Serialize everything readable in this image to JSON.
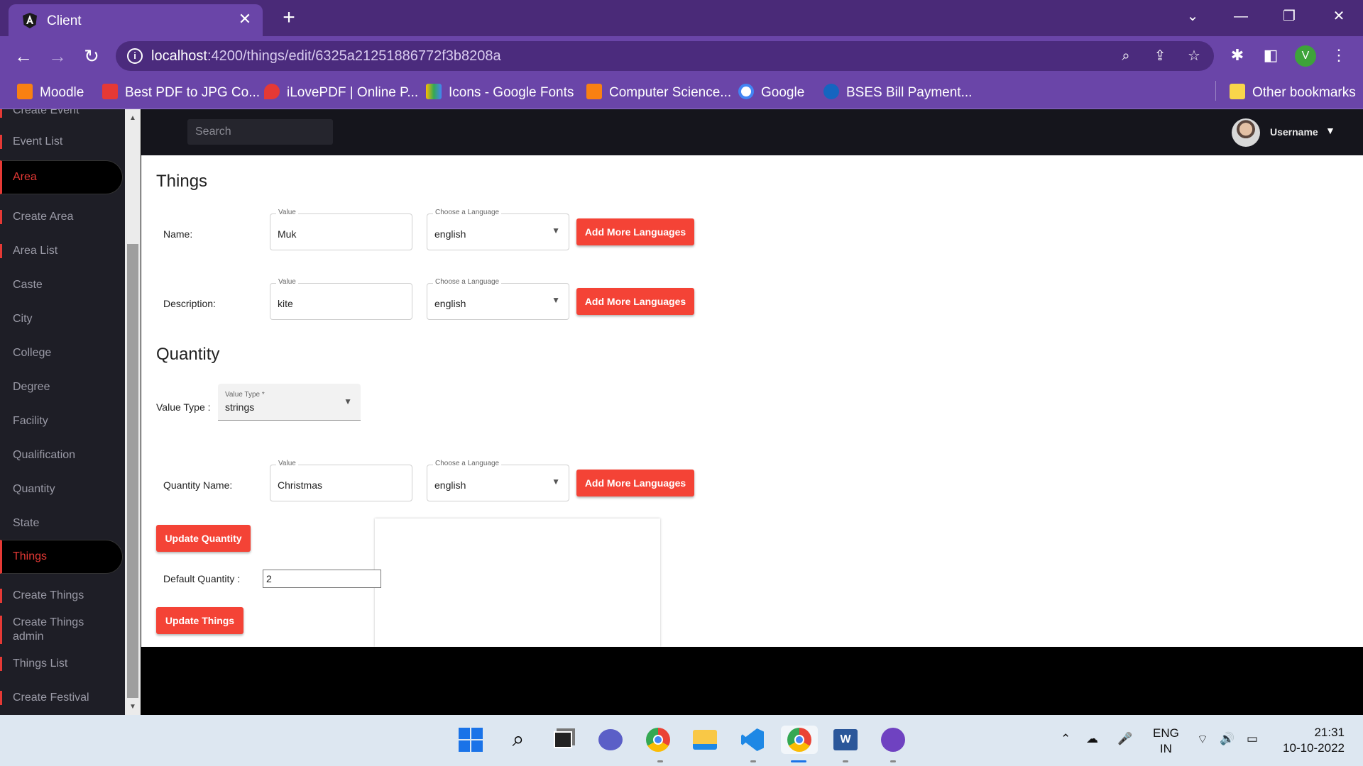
{
  "browser": {
    "tab_title": "Client",
    "url_host": "localhost",
    "url_rest": ":4200/things/edit/6325a21251886772f3b8208a",
    "bookmarks": [
      {
        "label": "Moodle",
        "color": "#f98012"
      },
      {
        "label": "Best PDF to JPG Co...",
        "color": "#e53935"
      },
      {
        "label": "iLovePDF | Online P...",
        "color": "#e53935"
      },
      {
        "label": "Icons - Google Fonts",
        "color": "#fbbc04"
      },
      {
        "label": "Computer Science...",
        "color": "#f98012"
      },
      {
        "label": "Google",
        "color": "#4285f4"
      },
      {
        "label": "BSES Bill Payment...",
        "color": "#1565c0"
      }
    ],
    "other_bookmarks": "Other bookmarks",
    "profile_initial": "V"
  },
  "sidebar": {
    "items": [
      {
        "label": "Create Event"
      },
      {
        "label": "Event List"
      },
      {
        "label": "Area",
        "active": true
      },
      {
        "label": "Create Area"
      },
      {
        "label": "Area List"
      },
      {
        "label": "Caste"
      },
      {
        "label": "City"
      },
      {
        "label": "College"
      },
      {
        "label": "Degree"
      },
      {
        "label": "Facility"
      },
      {
        "label": "Qualification"
      },
      {
        "label": "Quantity"
      },
      {
        "label": "State"
      },
      {
        "label": "Things",
        "active": true
      },
      {
        "label": "Create Things"
      },
      {
        "label": "Create Things admin"
      },
      {
        "label": "Things List"
      },
      {
        "label": "Create Festival"
      }
    ]
  },
  "header": {
    "search_placeholder": "Search",
    "username": "Username"
  },
  "main": {
    "things_heading": "Things",
    "name_label": "Name:",
    "description_label": "Description:",
    "value_label": "Value",
    "language_label": "Choose a Language",
    "name_value": "Muk",
    "description_value": "kite",
    "language_value": "english",
    "add_languages_button": "Add More Languages",
    "quantity_heading": "Quantity",
    "value_type_label": "Value Type :",
    "value_type_field_label": "Value Type *",
    "value_type_value": "strings",
    "quantity_name_label": "Quantity Name:",
    "quantity_name_value": "Christmas",
    "update_quantity_button": "Update Quantity",
    "default_quantity_label": "Default Quantity :",
    "default_quantity_value": "2",
    "update_things_button": "Update Things"
  },
  "taskbar": {
    "lang_1": "ENG",
    "lang_2": "IN",
    "time": "21:31",
    "date": "10-10-2022"
  },
  "colors": {
    "accent": "#f44336",
    "chrome": "#6a45a8",
    "sidebar": "#1e1e26"
  }
}
